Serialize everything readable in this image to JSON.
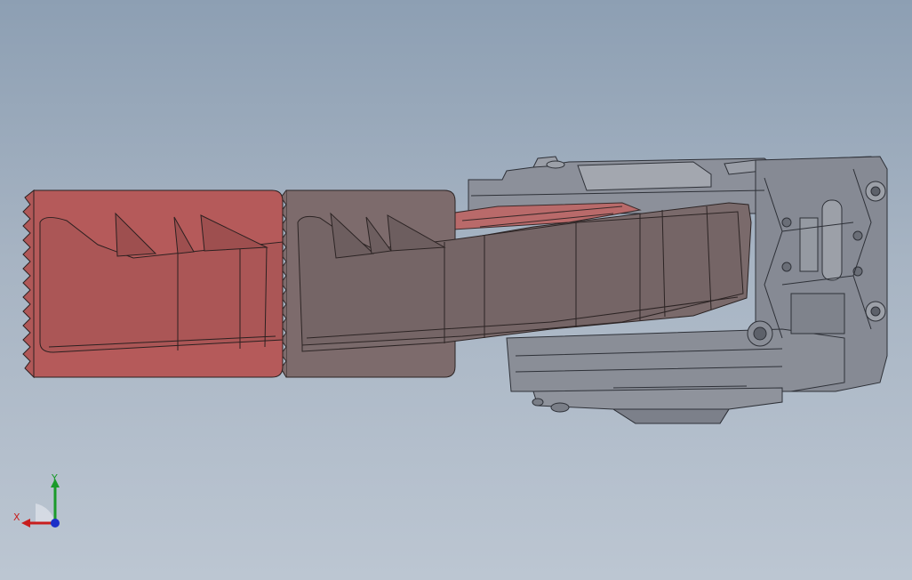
{
  "viewport": {
    "background_top": "#8d9fb3",
    "background_bottom": "#bcc6d2"
  },
  "model": {
    "parts": [
      {
        "name": "red-pedal-pad",
        "color": "#b55a5a"
      },
      {
        "name": "brown-pedal-arm",
        "color": "#7d6b6c"
      },
      {
        "name": "gray-bracket-housing",
        "color": "#8f939c"
      }
    ]
  },
  "triad": {
    "x_label": "X",
    "y_label": "Y",
    "x_color": "#c81e1e",
    "y_color": "#1a9a2a",
    "z_color": "#1a2fc8"
  }
}
